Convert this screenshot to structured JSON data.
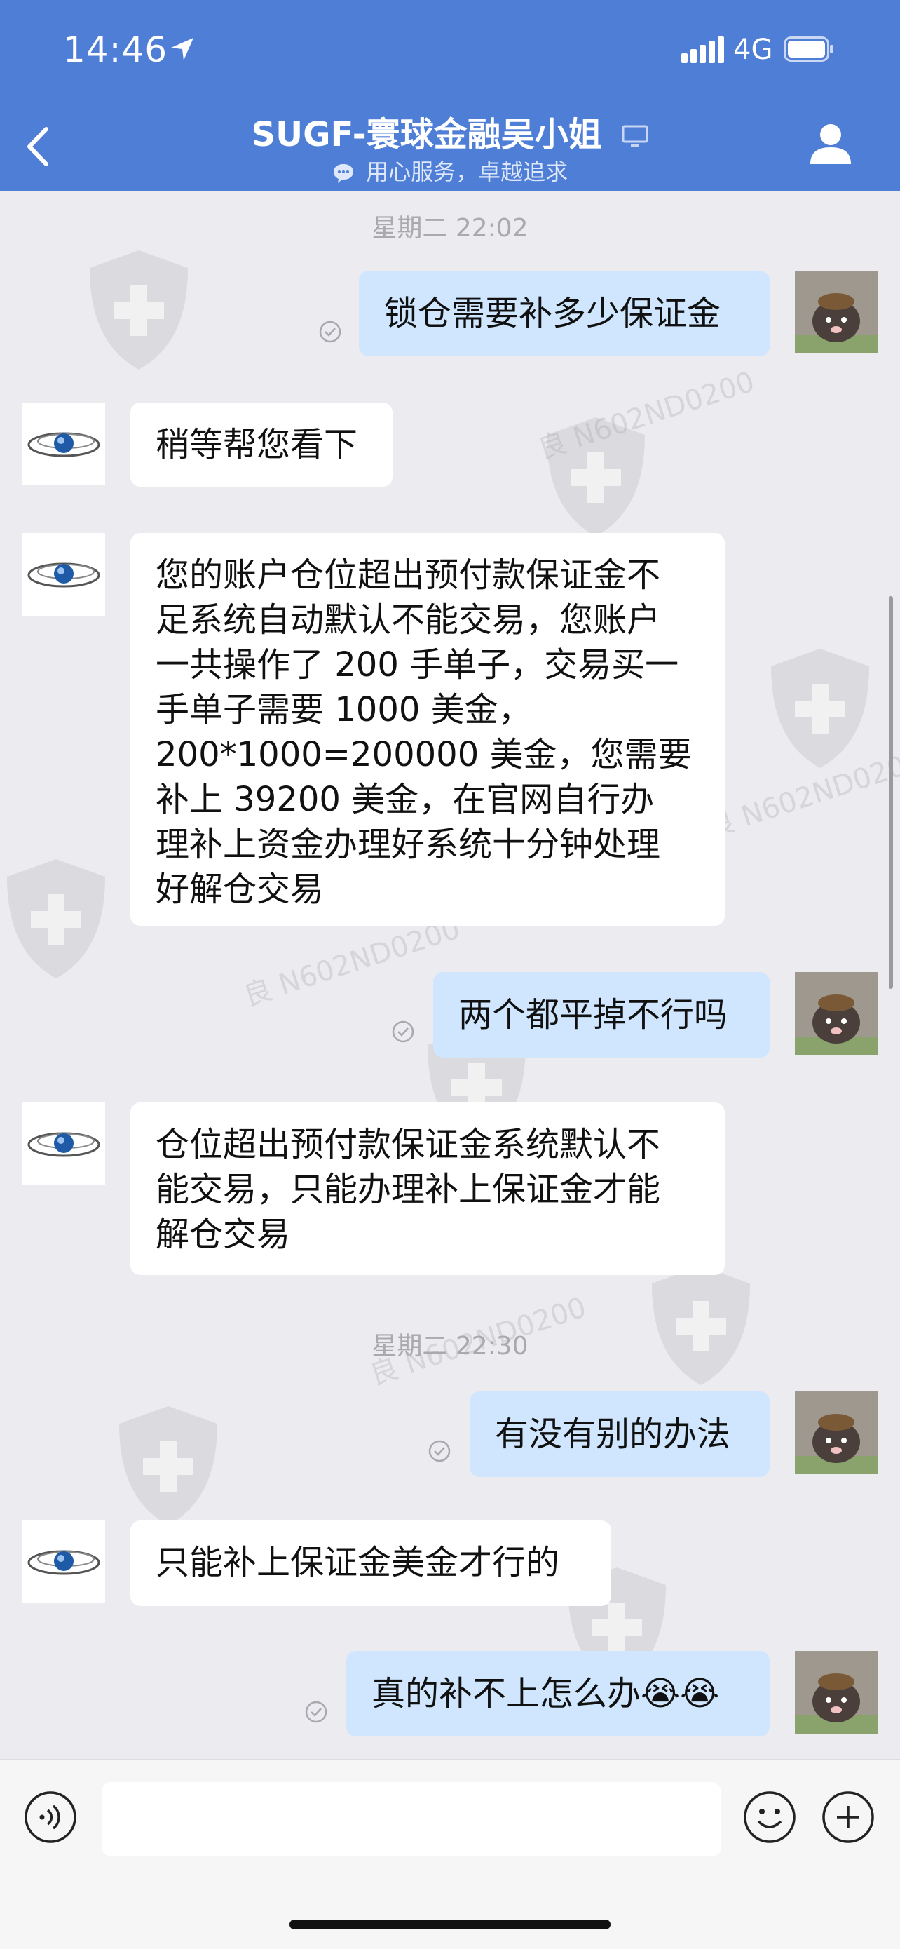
{
  "status_bar": {
    "time": "14:46",
    "network": "4G"
  },
  "header": {
    "title": "SUGF-寰球金融吴小姐",
    "subtitle": "用心服务，卓越追求"
  },
  "messages": [
    {
      "type": "timestamp",
      "text": "星期二 22:02"
    },
    {
      "type": "outgoing",
      "lines": [
        "锁仓需要补多少保证金"
      ]
    },
    {
      "type": "incoming",
      "lines": [
        "稍等帮您看下"
      ]
    },
    {
      "type": "incoming",
      "lines": [
        "您的账户仓位超出预付款保证金不",
        "足系统自动默认不能交易，您账户",
        "一共操作了 200 手单子，交易买一",
        "手单子需要 1000 美金，",
        "200*1000=200000 美金，您需要",
        "补上 39200 美金，在官网自行办",
        "理补上资金办理好系统十分钟处理",
        "好解仓交易"
      ]
    },
    {
      "type": "outgoing",
      "lines": [
        "两个都平掉不行吗"
      ]
    },
    {
      "type": "incoming",
      "lines": [
        "仓位超出预付款保证金系统默认不",
        "能交易，只能办理补上保证金才能",
        "解仓交易"
      ]
    },
    {
      "type": "timestamp",
      "text": "星期二 22:30"
    },
    {
      "type": "outgoing",
      "lines": [
        "有没有别的办法"
      ]
    },
    {
      "type": "incoming",
      "lines": [
        "只能补上保证金美金才行的"
      ]
    },
    {
      "type": "outgoing",
      "lines": [
        "真的补不上怎么办😭😭"
      ]
    }
  ],
  "watermark_text": "良 N602ND0200",
  "colors": {
    "header_bg": "#4f7ed6",
    "chat_bg": "#ebebf0",
    "outgoing_bubble": "#cfe6fe",
    "incoming_bubble": "#ffffff"
  },
  "icons": [
    "location-arrow-icon",
    "signal-icon",
    "battery-icon",
    "back-chevron-icon",
    "pc-icon",
    "chat-bubble-icon",
    "person-icon",
    "sent-check-icon",
    "voice-icon",
    "emoji-icon",
    "plus-icon"
  ]
}
